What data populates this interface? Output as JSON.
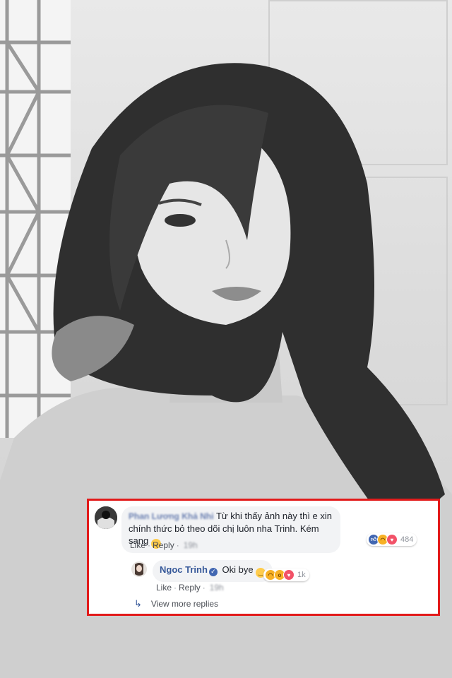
{
  "comment": {
    "author": "Phan Lương Khả Nhi",
    "text": "Từ khi thấy ảnh này thì e xin chính thức bỏ theo dõi chị luôn nha Trinh. Kém sang",
    "emoji_icon": "relieved-face-icon",
    "like_label": "Like",
    "separator": "·",
    "reply_label": "Reply",
    "time": "19h",
    "reaction_icons": [
      "like-icon",
      "haha-icon",
      "love-icon"
    ],
    "reaction_count": "484"
  },
  "reply": {
    "author": "Ngoc Trinh",
    "verified_icon": "verified-badge-icon",
    "text": "Oki bye",
    "emoji_icon": "smiling-face-icon",
    "like_label": "Like",
    "separator": "·",
    "reply_label": "Reply",
    "time": "19h",
    "reaction_icons": [
      "haha-icon",
      "wow-icon",
      "love-icon"
    ],
    "reaction_count": "1k"
  },
  "view_more_replies": "View more replies",
  "colors": {
    "highlight_border": "#e21a1a",
    "link": "#365899",
    "bubble": "#f2f3f5"
  }
}
